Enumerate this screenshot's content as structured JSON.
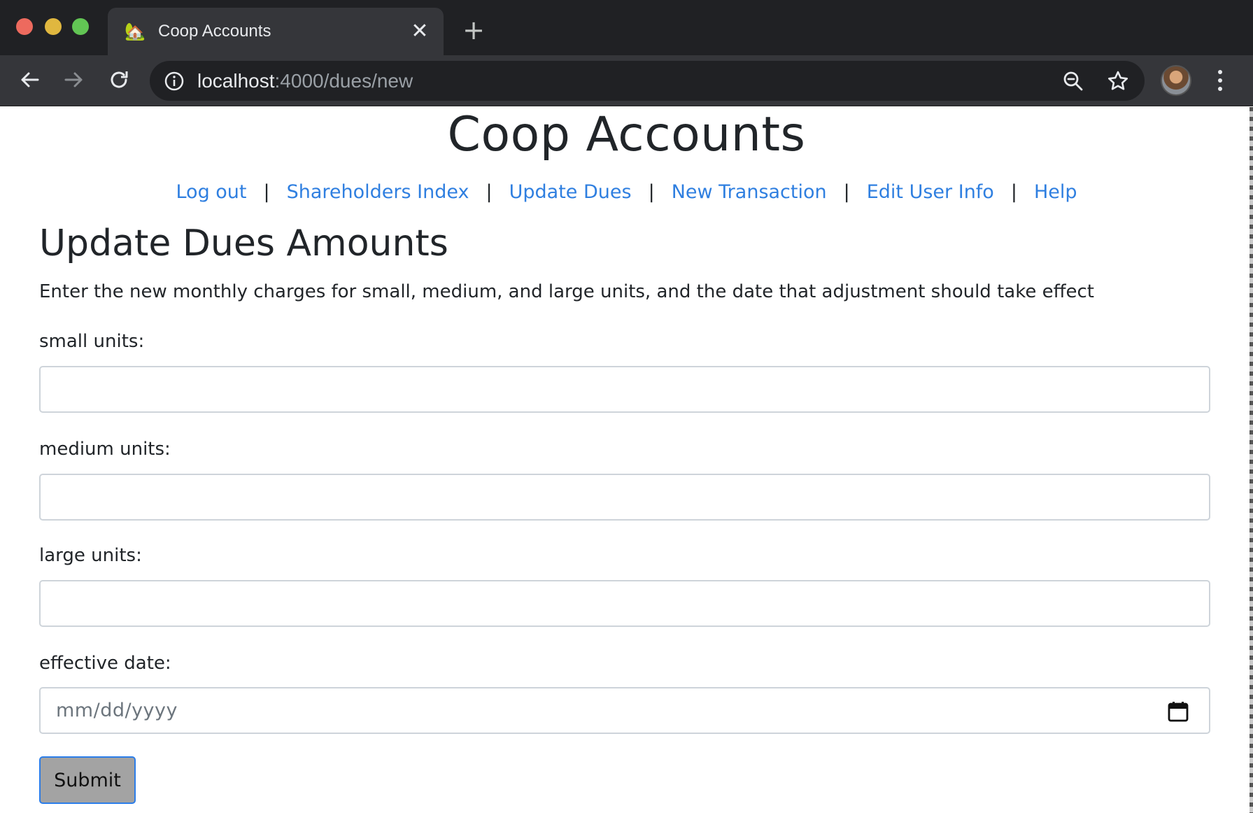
{
  "browser": {
    "tab": {
      "favicon": "🏡",
      "title": "Coop Accounts",
      "close_glyph": "✕"
    },
    "new_tab_glyph": "+",
    "url": {
      "host": "localhost",
      "path": ":4000/dues/new"
    },
    "icons": [
      "back-arrow-icon",
      "forward-arrow-icon",
      "reload-icon",
      "info-icon",
      "zoom-out-icon",
      "star-icon",
      "avatar",
      "menu-dots-icon"
    ]
  },
  "site": {
    "title": "Coop Accounts",
    "nav": [
      {
        "label": "Log out"
      },
      {
        "label": "Shareholders Index"
      },
      {
        "label": "Update Dues"
      },
      {
        "label": "New Transaction"
      },
      {
        "label": "Edit User Info"
      },
      {
        "label": "Help"
      }
    ],
    "nav_separator": "|"
  },
  "form": {
    "heading": "Update Dues Amounts",
    "intro": "Enter the new monthly charges for small, medium, and large units, and the date that adjustment should take effect",
    "small_label": "small units:",
    "small_value": "",
    "medium_label": "medium units:",
    "medium_value": "",
    "large_label": "large units:",
    "large_value": "",
    "date_label": "effective date:",
    "date_placeholder": "mm/dd/yyyy",
    "submit_label": "Submit"
  },
  "colors": {
    "link": "#2f7fe0",
    "chrome_dark": "#202124",
    "chrome_tab": "#35363a",
    "submit_bg": "#a3a3a3",
    "submit_border": "#2b7de9"
  }
}
